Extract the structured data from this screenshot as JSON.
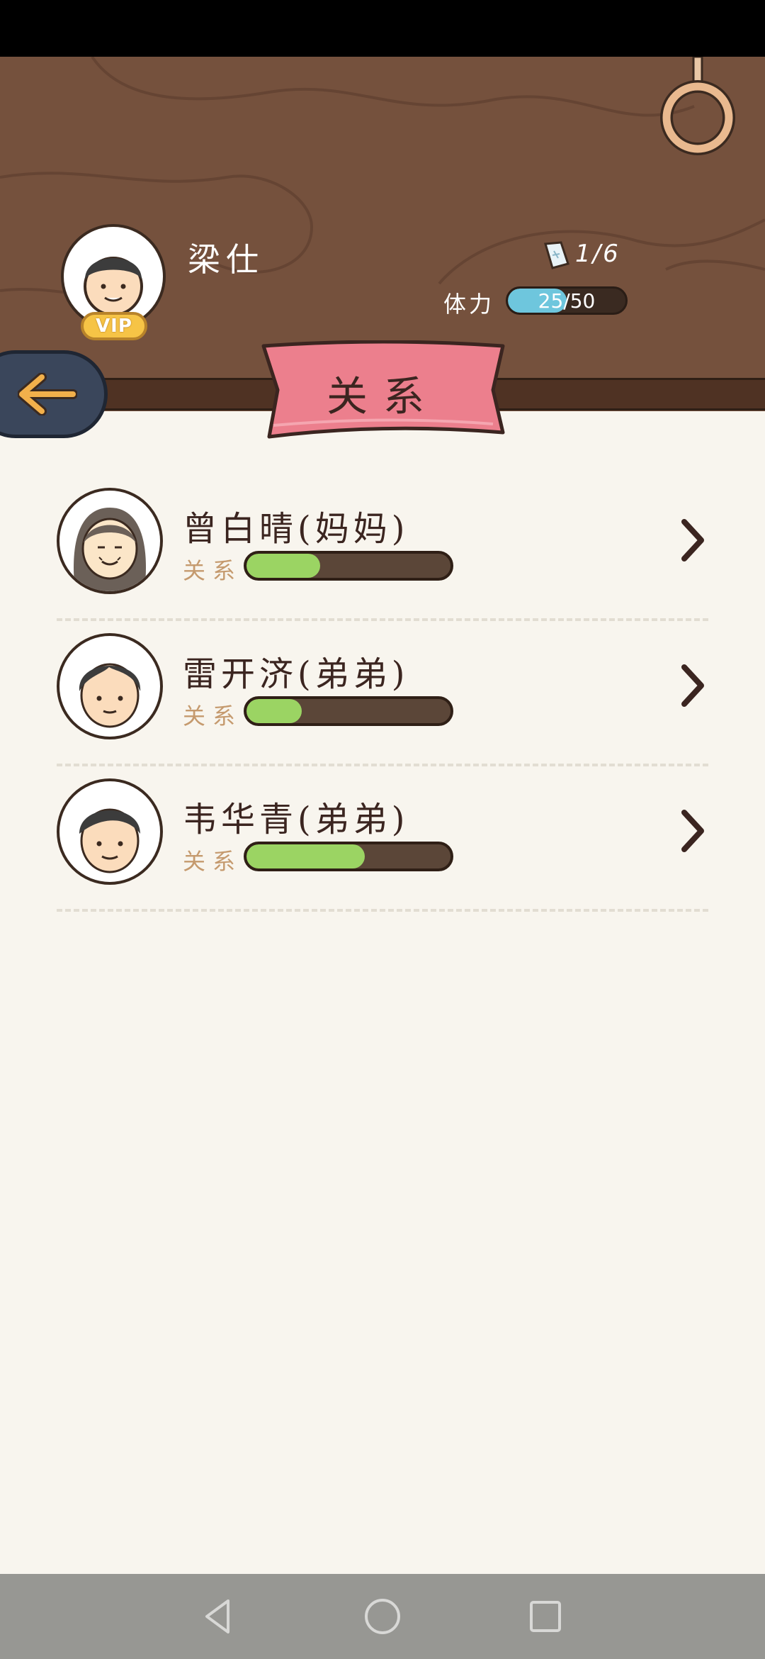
{
  "player": {
    "name": "梁仕",
    "vip_label": "VIP",
    "tickets": "1/6",
    "stamina_label": "体力",
    "stamina_text": "25/50",
    "stamina_fraction": 0.5
  },
  "page": {
    "title": "关系"
  },
  "relations": [
    {
      "name": "曾白晴(妈妈)",
      "label": "关系",
      "value": 0.36
    },
    {
      "name": "雷开济(弟弟)",
      "label": "关系",
      "value": 0.27
    },
    {
      "name": "韦华青(弟弟)",
      "label": "关系",
      "value": 0.58
    }
  ],
  "colors": {
    "wood": "#75513d",
    "banner": "#ec7f8d",
    "progress_green": "#9bd463",
    "stamina_blue": "#6ec6dd",
    "back_arrow": "#f2b04b"
  },
  "icons": {
    "back": "arrow-left-icon",
    "ring": "hanging-ring-icon",
    "ticket": "ticket-icon",
    "chevron": "chevron-right-icon",
    "nav": [
      "nav-back-icon",
      "nav-home-icon",
      "nav-recents-icon"
    ]
  }
}
